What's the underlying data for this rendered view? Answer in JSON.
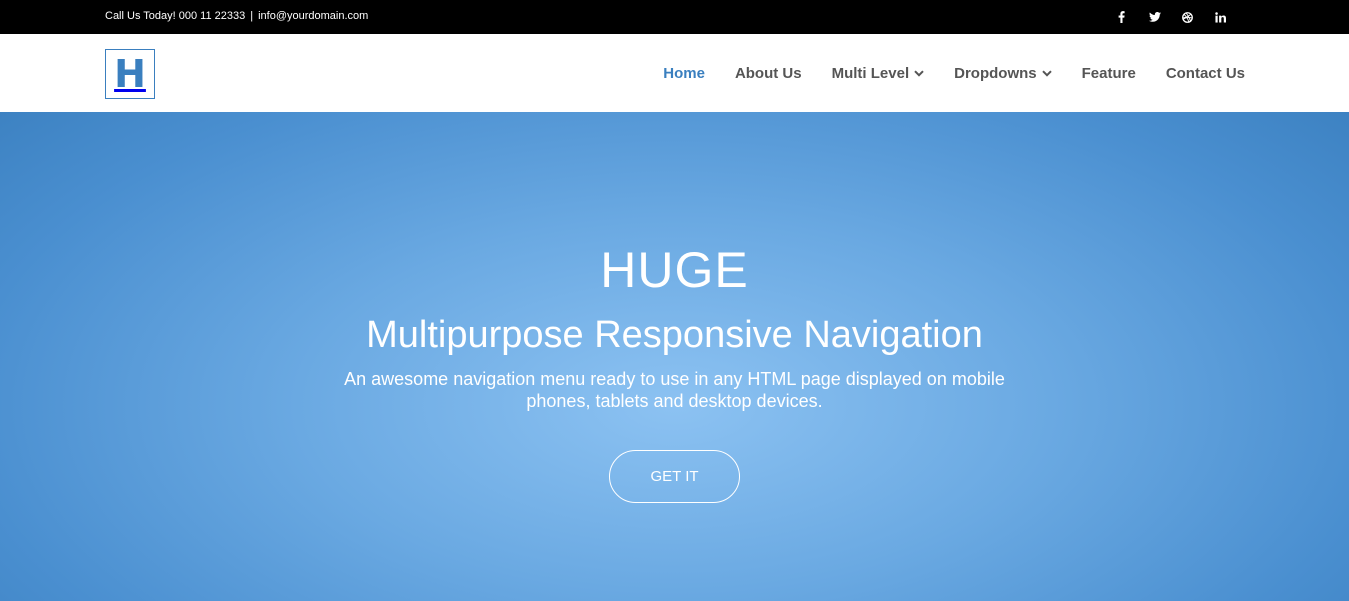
{
  "topbar": {
    "phone_text": "Call Us Today! 000 11 22333",
    "separator": "|",
    "email": "info@yourdomain.com",
    "social": [
      "facebook-icon",
      "twitter-icon",
      "dribbble-icon",
      "linkedin-icon"
    ]
  },
  "navbar": {
    "logo_letter": "H",
    "items": [
      {
        "label": "Home",
        "active": true,
        "has_dropdown": false
      },
      {
        "label": "About Us",
        "active": false,
        "has_dropdown": false
      },
      {
        "label": "Multi Level",
        "active": false,
        "has_dropdown": true
      },
      {
        "label": "Dropdowns",
        "active": false,
        "has_dropdown": true
      },
      {
        "label": "Feature",
        "active": false,
        "has_dropdown": false
      },
      {
        "label": "Contact Us",
        "active": false,
        "has_dropdown": false
      }
    ]
  },
  "hero": {
    "title": "HUGE",
    "subtitle": "Multipurpose Responsive Navigation",
    "description": "An awesome navigation menu ready to use in any HTML page displayed on mobile phones, tablets and desktop devices.",
    "cta_label": "GET IT"
  },
  "colors": {
    "accent": "#3a7fbf",
    "topbar_bg": "#000000",
    "menu_text": "#555555",
    "hero_center": "#8cc2f2",
    "hero_edge": "#3a7fbf"
  }
}
